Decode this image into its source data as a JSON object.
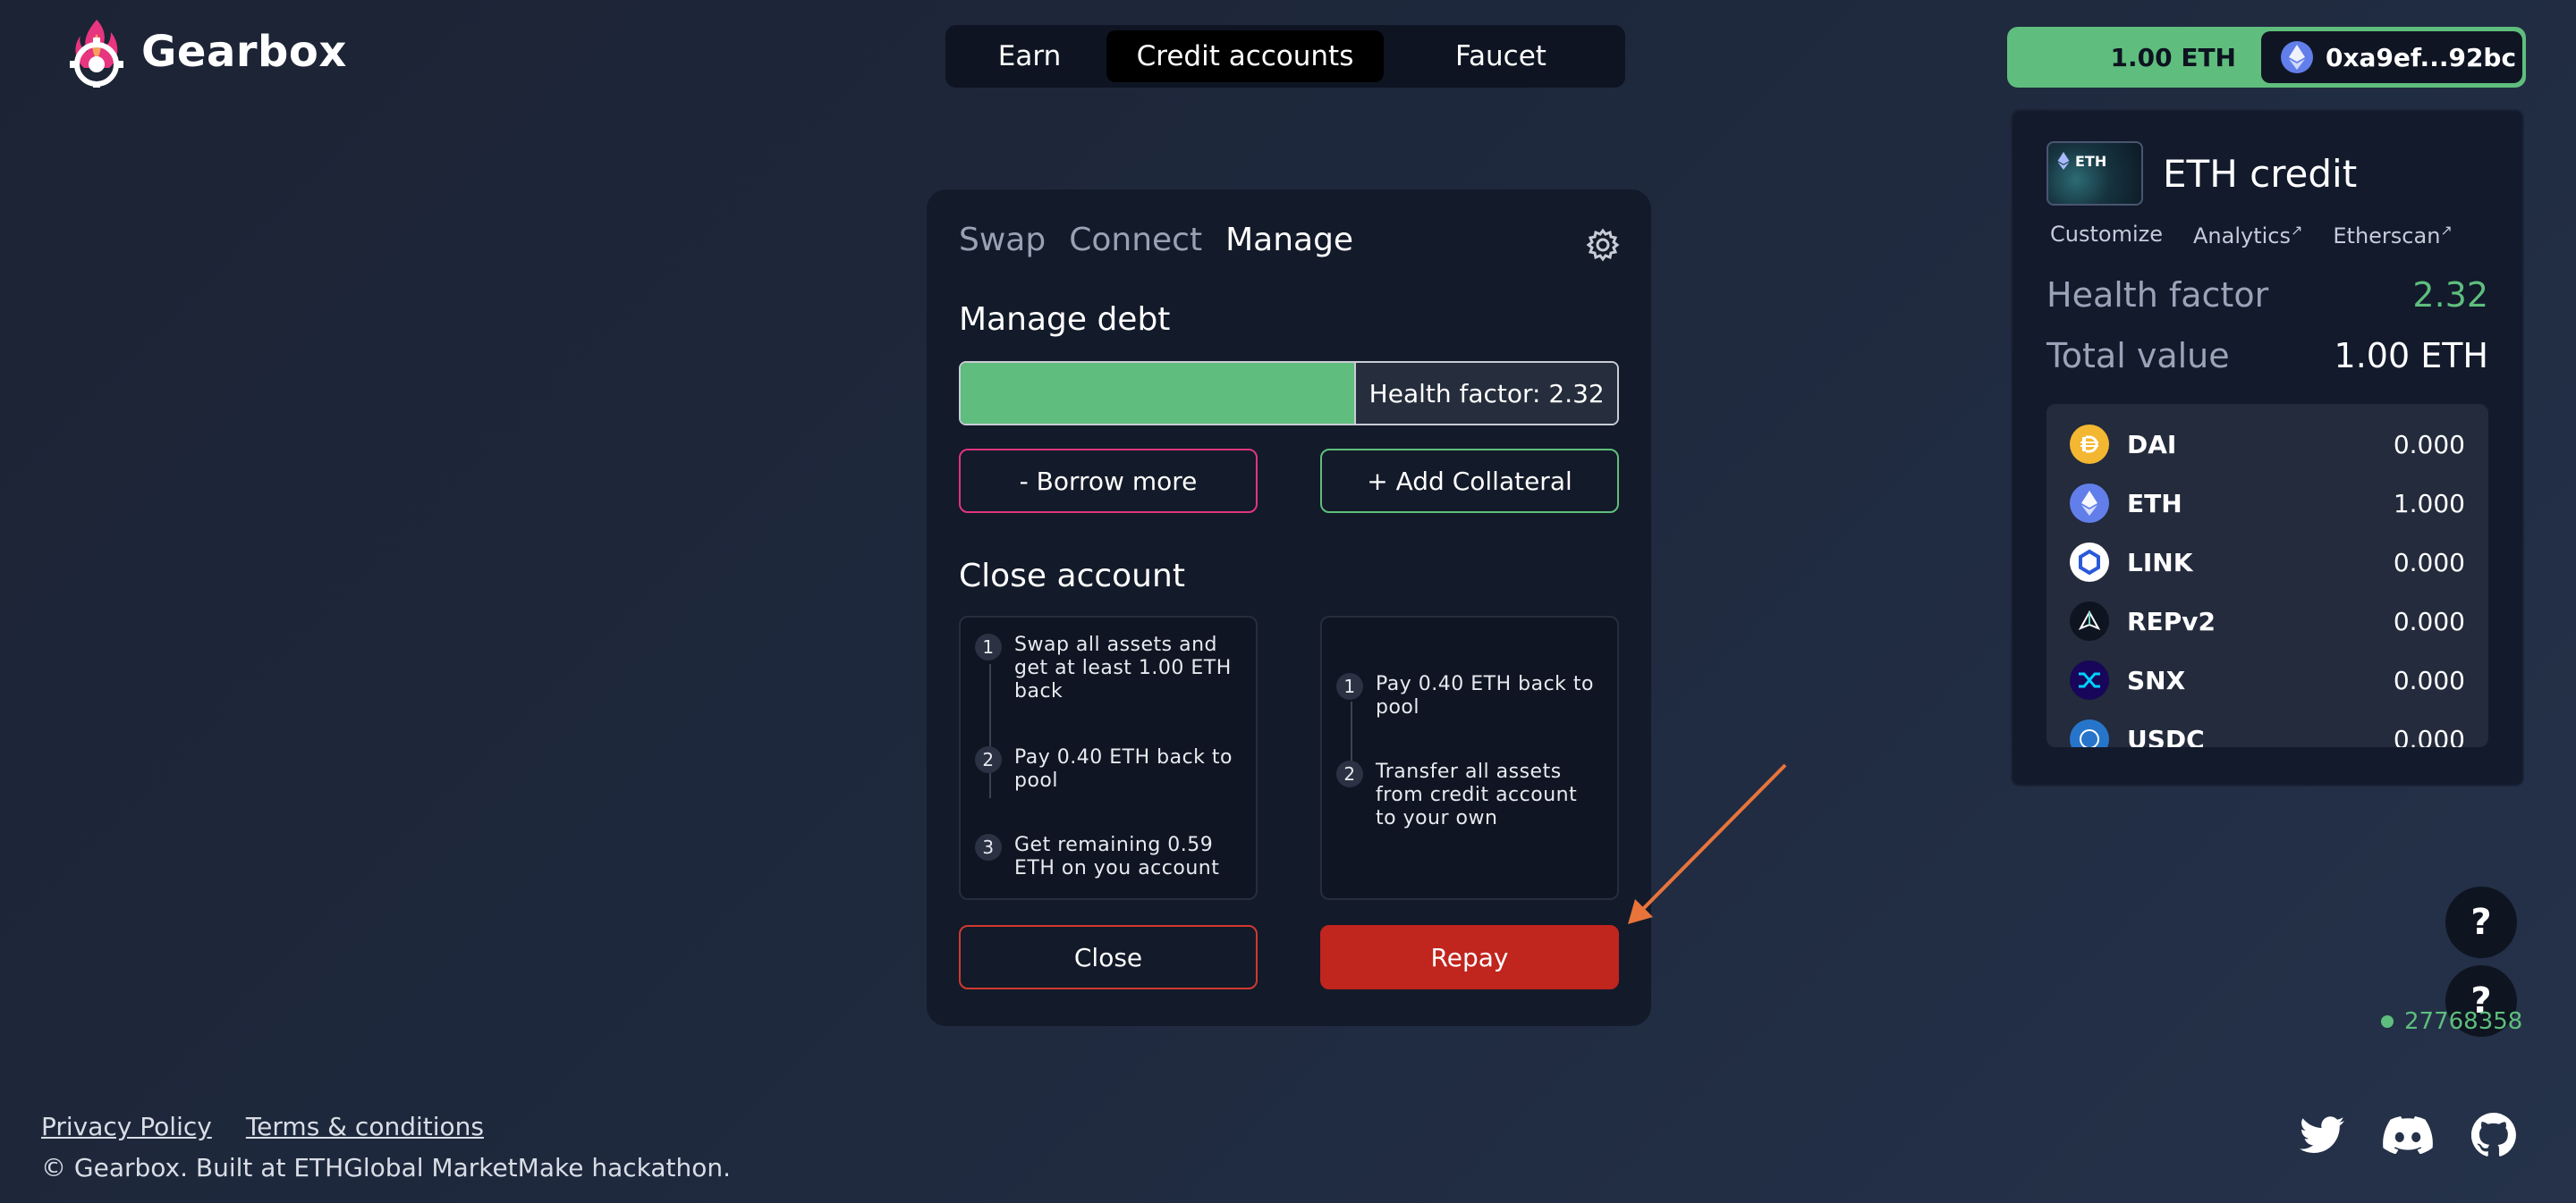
{
  "app": {
    "name": "Gearbox"
  },
  "nav": {
    "tabs": [
      "Earn",
      "Credit accounts",
      "Faucet"
    ],
    "active": "Credit accounts"
  },
  "wallet": {
    "balance": "1.00 ETH",
    "address": "0xa9ef...92bc"
  },
  "credit_account": {
    "thumb_label": "ETH",
    "title": "ETH credit",
    "links": {
      "customize": "Customize",
      "analytics": "Analytics",
      "etherscan": "Etherscan"
    },
    "health_label": "Health factor",
    "health_value": "2.32",
    "total_label": "Total value",
    "total_value": "1.00 ETH",
    "assets": [
      {
        "name": "DAI",
        "value": "0.000"
      },
      {
        "name": "ETH",
        "value": "1.000"
      },
      {
        "name": "LINK",
        "value": "0.000"
      },
      {
        "name": "REPv2",
        "value": "0.000"
      },
      {
        "name": "SNX",
        "value": "0.000"
      },
      {
        "name": "USDC",
        "value": "0.000"
      }
    ]
  },
  "panel": {
    "tabs": [
      "Swap",
      "Connect",
      "Manage"
    ],
    "active_tab": "Manage",
    "manage_debt_title": "Manage debt",
    "health_bar_label": "Health factor: 2.32",
    "health_bar_fill": 0.6,
    "borrow_more": "- Borrow more",
    "add_collateral": "+ Add Collateral",
    "close_account_title": "Close account",
    "close_steps": [
      {
        "num": "1",
        "text": "Swap all assets and get at least 1.00 ETH back"
      },
      {
        "num": "2",
        "text": "Pay 0.40 ETH back to pool"
      },
      {
        "num": "3",
        "text": "Get remaining 0.59 ETH on you account"
      }
    ],
    "repay_steps": [
      {
        "num": "1",
        "text": "Pay 0.40 ETH back to pool"
      },
      {
        "num": "2",
        "text": "Transfer all assets from credit account to your own"
      }
    ],
    "close_button": "Close",
    "repay_button": "Repay"
  },
  "help": {
    "label": "?"
  },
  "block_number": "27768358",
  "footer": {
    "privacy": "Privacy Policy",
    "terms": "Terms & conditions",
    "copyright": "© Gearbox. Built at ETHGlobal MarketMake hackathon."
  },
  "colors": {
    "accent_green": "#5fbe7d",
    "danger_red": "#c0251e",
    "pink": "#e0357d",
    "arrow": "#e8743b"
  },
  "icons": [
    "gearbox-logo",
    "eth-icon",
    "settings-gear-icon",
    "dai-icon",
    "eth-icon",
    "link-icon",
    "repv2-icon",
    "snx-icon",
    "usdc-icon",
    "twitter-icon",
    "discord-icon",
    "github-icon"
  ]
}
